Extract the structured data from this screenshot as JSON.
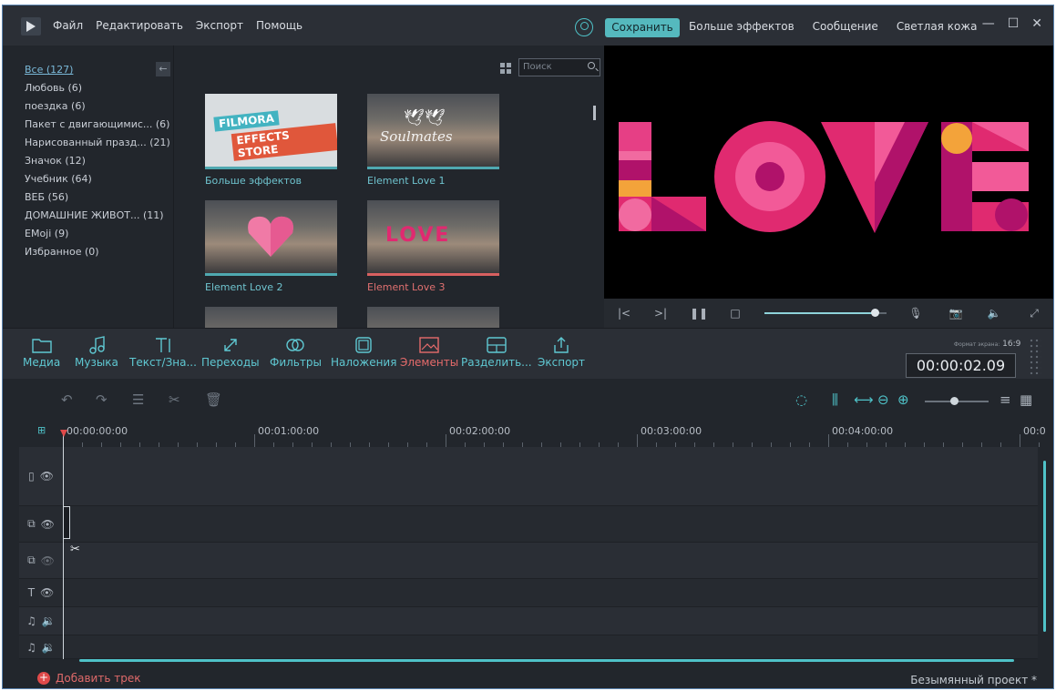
{
  "menu": [
    "Файл",
    "Редактировать",
    "Экспорт",
    "Помощь"
  ],
  "topbar": {
    "save_label": "Сохранить",
    "links": [
      "Больше эффектов",
      "Сообщение",
      "Светлая кожа"
    ],
    "window_controls": [
      "—",
      "☐",
      "✕"
    ]
  },
  "categories": [
    "Все (127)",
    "Любовь (6)",
    "поездка (6)",
    "Пакет с двигающимис... (6)",
    "Нарисованный празд... (21)",
    "Значок (12)",
    "Учебник (64)",
    "ВЕБ (56)",
    "ДОМАШНИЕ ЖИВОТ... (11)",
    "EMoji (9)",
    "Избранное (0)"
  ],
  "search": {
    "placeholder": "Поиск"
  },
  "effects": [
    {
      "label": "Больше эффектов",
      "thumb_text_1": "FILMORA",
      "thumb_text_2": "EFFECTS STORE"
    },
    {
      "label": "Element Love 1",
      "thumb_text": "Soulmates"
    },
    {
      "label": "Element Love 2"
    },
    {
      "label": "Element Love 3",
      "thumb_text": "LOVE"
    }
  ],
  "preview": {
    "progress": 0.9
  },
  "tools": [
    "Медиа",
    "Музыка",
    "Текст/Зна...",
    "Переходы",
    "Фильтры",
    "Наложения",
    "Элементы",
    "Разделить...",
    "Экспорт"
  ],
  "aspect": {
    "label": "Формат экрана:",
    "value": "16:9"
  },
  "timecode": "00:00:02.09",
  "ruler": [
    "00:00:00:00",
    "00:01:00:00",
    "00:02:00:00",
    "00:03:00:00",
    "00:04:00:00",
    "00:0"
  ],
  "timeline": {
    "zoom": 0.45
  },
  "footer": {
    "add_track": "Добавить трек",
    "project_name": "Безымянный проект *"
  },
  "colors": {
    "accent": "#55b9be",
    "active_tool": "#e66b6b",
    "love_pink": "#e02a70",
    "love_magenta": "#b0126a",
    "love_orange": "#f3a33a"
  }
}
